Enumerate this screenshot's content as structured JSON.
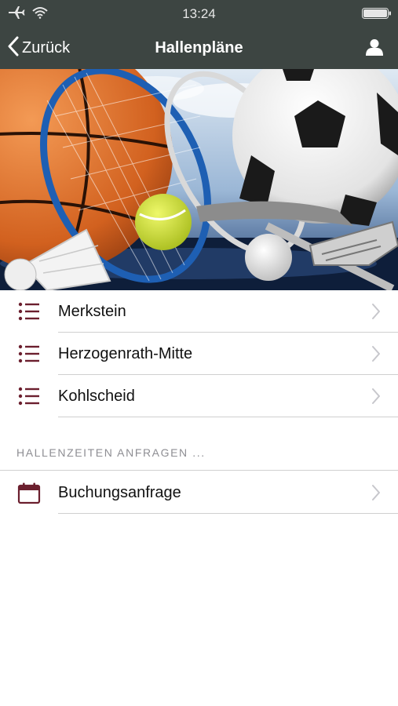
{
  "status_bar": {
    "time": "13:24"
  },
  "nav": {
    "back_label": "Zurück",
    "title": "Hallenpläne"
  },
  "locations": [
    {
      "label": "Merkstein",
      "icon": "list-icon"
    },
    {
      "label": "Herzogenrath-Mitte",
      "icon": "list-icon"
    },
    {
      "label": "Kohlscheid",
      "icon": "list-icon"
    }
  ],
  "section": {
    "header": "HALLENZEITEN ANFRAGEN ..."
  },
  "booking": {
    "label": "Buchungsanfrage",
    "icon": "calendar-icon"
  },
  "colors": {
    "nav_bg": "#3d4542",
    "accent": "#6b1f2e"
  }
}
